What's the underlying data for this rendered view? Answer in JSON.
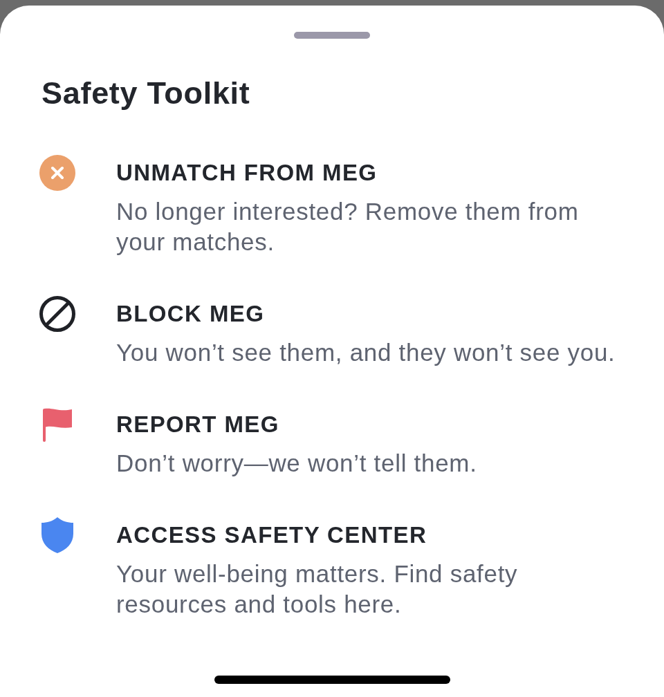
{
  "sheet": {
    "title": "Safety Toolkit"
  },
  "options": [
    {
      "kind": "unmatch",
      "title": "UNMATCH FROM MEG",
      "description": "No longer interested? Remove them from your matches."
    },
    {
      "kind": "block",
      "title": "BLOCK MEG",
      "description": "You won’t see them, and they won’t see you."
    },
    {
      "kind": "report",
      "title": "REPORT MEG",
      "description": "Don’t worry—we won’t tell them."
    },
    {
      "kind": "safety",
      "title": "ACCESS SAFETY CENTER",
      "description": "Your well-being matters. Find safety resources and tools here."
    }
  ]
}
